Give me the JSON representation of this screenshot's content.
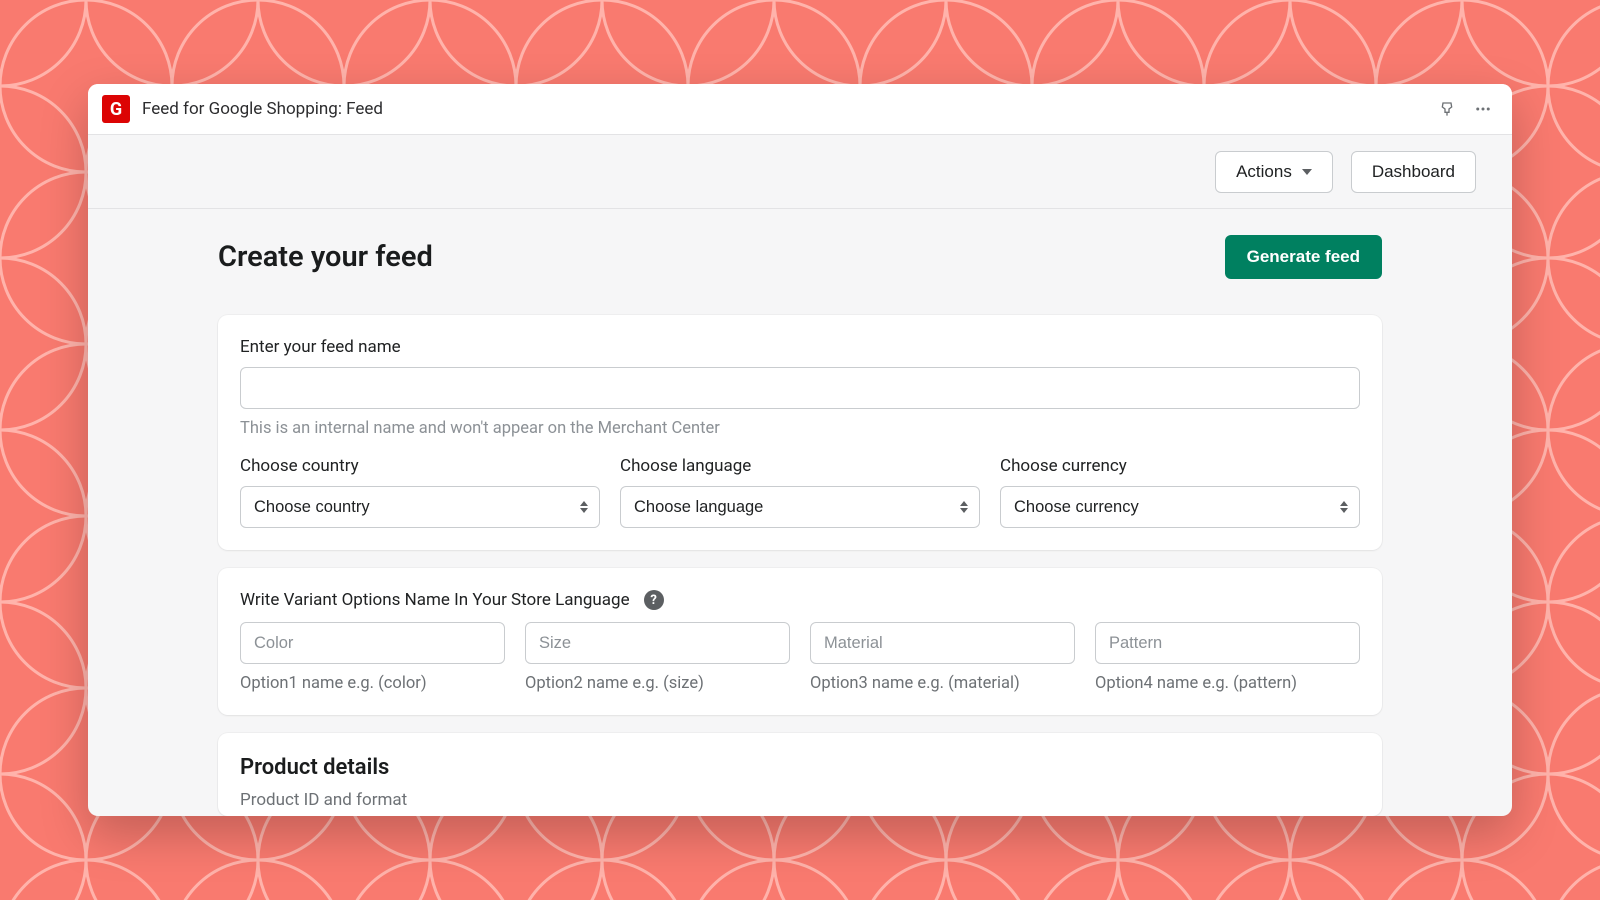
{
  "header": {
    "app_logo_letter": "G",
    "title": "Feed for Google Shopping: Feed"
  },
  "toolbar": {
    "actions_label": "Actions",
    "dashboard_label": "Dashboard"
  },
  "page": {
    "title": "Create your feed",
    "generate_label": "Generate feed"
  },
  "feed_name": {
    "label": "Enter your feed name",
    "value": "",
    "help": "This is an internal name and won't appear on the Merchant Center"
  },
  "country": {
    "label": "Choose country",
    "selected": "Choose country"
  },
  "language": {
    "label": "Choose language",
    "selected": "Choose language"
  },
  "currency": {
    "label": "Choose currency",
    "selected": "Choose currency"
  },
  "variants": {
    "heading": "Write Variant Options Name In Your Store Language",
    "options": [
      {
        "placeholder": "Color",
        "hint": "Option1 name e.g. (color)"
      },
      {
        "placeholder": "Size",
        "hint": "Option2 name e.g. (size)"
      },
      {
        "placeholder": "Material",
        "hint": "Option3 name e.g. (material)"
      },
      {
        "placeholder": "Pattern",
        "hint": "Option4 name e.g. (pattern)"
      }
    ]
  },
  "product_details": {
    "title": "Product details",
    "subtitle": "Product ID and format"
  }
}
